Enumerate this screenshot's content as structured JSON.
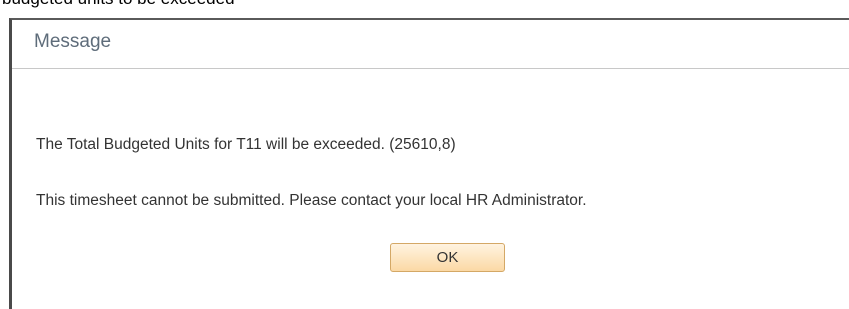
{
  "background": {
    "partial_text": "budgeted units to be exceeded"
  },
  "dialog": {
    "title": "Message",
    "line1": "The Total Budgeted Units for T11 will be exceeded. (25610,8)",
    "line2": "This timesheet cannot be submitted. Please contact your local HR Administrator.",
    "ok_label": "OK"
  },
  "colors": {
    "title_text": "#5e6c7a",
    "button_top": "#fff3e0",
    "button_bottom": "#fbd9a5",
    "button_border": "#d4a866"
  }
}
